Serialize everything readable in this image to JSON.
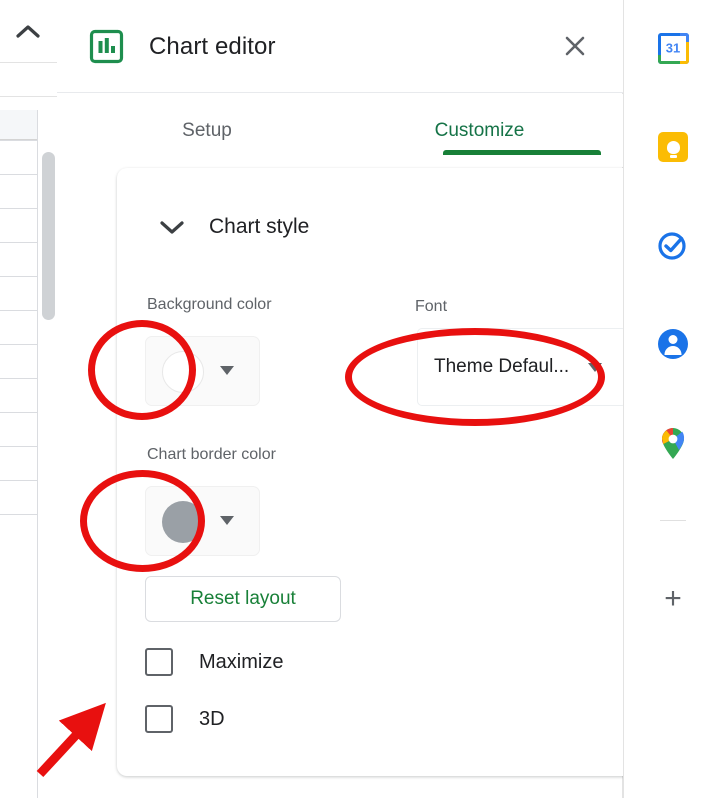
{
  "window": {
    "left_strip": {
      "collapse_icon": "chevron-up-icon",
      "scrollbar": "vertical-scrollbar"
    }
  },
  "panel": {
    "icon": "bar-chart-icon",
    "title": "Chart editor",
    "close_icon": "close-icon",
    "tabs": [
      {
        "label": "Setup",
        "active": false
      },
      {
        "label": "Customize",
        "active": true
      }
    ],
    "section": {
      "toggle_icon": "chevron-down-icon",
      "title": "Chart style",
      "fields": {
        "background_color": {
          "label": "Background color",
          "swatch_color": "#ffffff",
          "caret_icon": "dropdown-caret-icon"
        },
        "font": {
          "label": "Font",
          "value": "Theme Defaul...",
          "caret_icon": "dropdown-caret-icon"
        },
        "chart_border_color": {
          "label": "Chart border color",
          "swatch_color": "#9aa0a6",
          "caret_icon": "dropdown-caret-icon"
        }
      },
      "reset_button": "Reset layout",
      "checkboxes": [
        {
          "label": "Maximize",
          "checked": false
        },
        {
          "label": "3D",
          "checked": false
        }
      ]
    }
  },
  "side_rail": {
    "items": [
      {
        "name": "google-calendar-icon",
        "badge": "31"
      },
      {
        "name": "google-keep-icon"
      },
      {
        "name": "google-tasks-icon"
      },
      {
        "name": "google-contacts-icon"
      },
      {
        "name": "google-maps-icon"
      }
    ],
    "add_button": "+"
  },
  "annotations": {
    "accent_color": "#e8100f",
    "circles": [
      "background-color-swatch",
      "font-dropdown",
      "chart-border-color-swatch"
    ],
    "arrow_target": "3d-checkbox"
  },
  "colors": {
    "brand_green": "#188038",
    "tab_active": "#157347",
    "text_primary": "#202124",
    "text_secondary": "#5f6368",
    "annotation_red": "#e8100f"
  }
}
